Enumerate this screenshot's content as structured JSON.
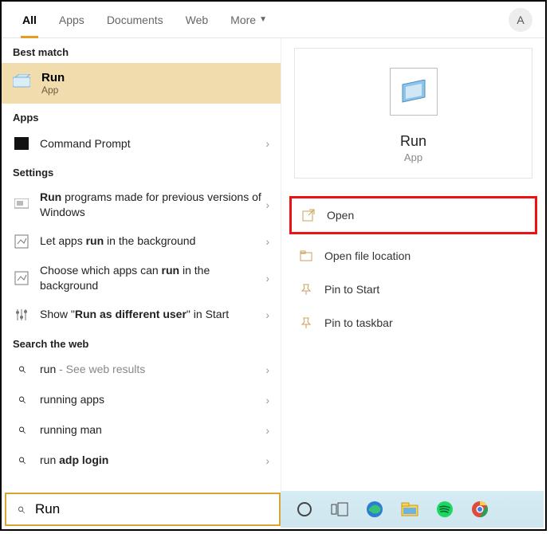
{
  "tabs": {
    "items": [
      "All",
      "Apps",
      "Documents",
      "Web",
      "More"
    ],
    "active": 0,
    "avatar_letter": "A"
  },
  "left": {
    "best_match_label": "Best match",
    "bm": {
      "title": "Run",
      "sub": "App"
    },
    "apps_label": "Apps",
    "apps": [
      {
        "name": "Command Prompt"
      }
    ],
    "settings_label": "Settings",
    "settings": [
      {
        "pre": "",
        "bold": "Run",
        "post": " programs made for previous versions of Windows"
      },
      {
        "pre": "Let apps ",
        "bold": "run",
        "post": " in the background"
      },
      {
        "pre": "Choose which apps can ",
        "bold": "run",
        "post": " in the background"
      },
      {
        "pre": "Show \"",
        "bold": "Run as different user",
        "post": "\" in Start"
      }
    ],
    "web_label": "Search the web",
    "web": [
      {
        "term": "run",
        "suffix": " - See web results"
      },
      {
        "term": "running apps",
        "suffix": ""
      },
      {
        "term": "running man",
        "suffix": ""
      },
      {
        "term": "run ",
        "bold2": "adp login",
        "suffix": ""
      }
    ]
  },
  "right": {
    "title": "Run",
    "sub": "App",
    "actions": [
      {
        "label": "Open",
        "highlighted": true
      },
      {
        "label": "Open file location"
      },
      {
        "label": "Pin to Start"
      },
      {
        "label": "Pin to taskbar"
      }
    ]
  },
  "search": {
    "value": "Run"
  }
}
